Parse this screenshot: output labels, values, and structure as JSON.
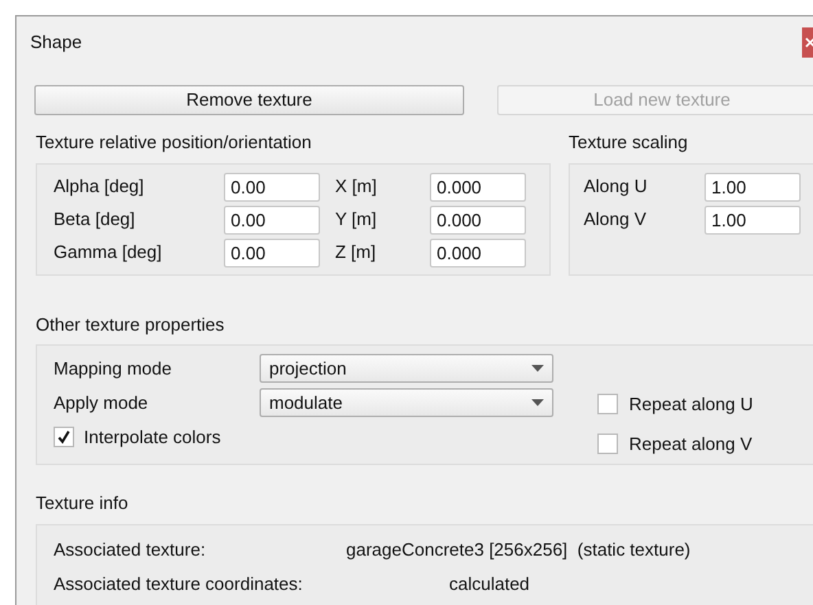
{
  "window": {
    "title": "Shape"
  },
  "buttons": [
    {
      "label": "Remove texture",
      "disabled": false
    },
    {
      "label": "Load new texture",
      "disabled": true
    }
  ],
  "position": {
    "title": "Texture relative position/orientation",
    "rows": [
      {
        "label": "Alpha [deg]",
        "value": "0.00",
        "label_2": "X [m]",
        "value_2": "0.000"
      },
      {
        "label": "Beta [deg]",
        "value": "0.00",
        "label_2": "Y [m]",
        "value_2": "0.000"
      },
      {
        "label": "Gamma [deg]",
        "value": "0.00",
        "label_2": "Z [m]",
        "value_2": "0.000"
      }
    ]
  },
  "scaling": {
    "title": "Texture scaling",
    "rows": [
      {
        "label": "Along U",
        "value": "1.00"
      },
      {
        "label": "Along V",
        "value": "1.00"
      }
    ]
  },
  "properties": {
    "title": "Other texture properties",
    "combos": [
      {
        "label": "Mapping mode",
        "value": "projection"
      },
      {
        "label": "Apply mode",
        "value": "modulate"
      }
    ],
    "interpolate": {
      "label": "Interpolate colors",
      "checked": true
    },
    "repeat": [
      {
        "label": "Repeat along U",
        "checked": false
      },
      {
        "label": "Repeat along V",
        "checked": false
      }
    ]
  },
  "info": {
    "title": "Texture info",
    "rows": [
      {
        "label": "Associated texture:",
        "value": "garageConcrete3 [256x256]  (static texture)"
      },
      {
        "label": "Associated texture coordinates:",
        "value": "calculated"
      }
    ]
  }
}
